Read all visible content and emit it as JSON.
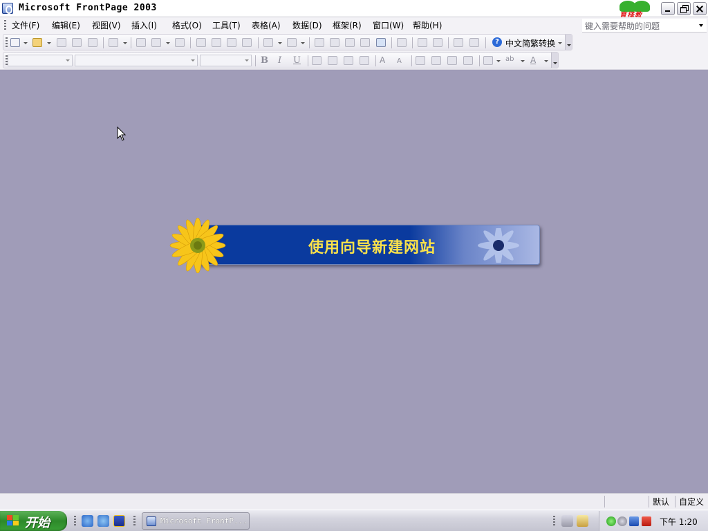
{
  "window": {
    "title": "Microsoft FrontPage 2003"
  },
  "logo": {
    "text": "育择教"
  },
  "menu": {
    "items": [
      {
        "label": "文件(F)"
      },
      {
        "label": "编辑(E)"
      },
      {
        "label": "视图(V)"
      },
      {
        "label": "插入(I)"
      },
      {
        "label": "格式(O)"
      },
      {
        "label": "工具(T)"
      },
      {
        "label": "表格(A)"
      },
      {
        "label": "数据(D)"
      },
      {
        "label": "框架(R)"
      },
      {
        "label": "窗口(W)"
      },
      {
        "label": "帮助(H)"
      }
    ]
  },
  "help_search": {
    "placeholder": "键入需要帮助的问题"
  },
  "toolbar": {
    "chinese_convert_label": "中文简繁转换",
    "help_glyph": "?"
  },
  "format_toolbar": {
    "bold": "B",
    "italic": "I",
    "underline": "U",
    "grow_font": "A",
    "shrink_font": "A",
    "font_color": "A",
    "spelling": "ab"
  },
  "banner": {
    "label": "使用向导新建网站"
  },
  "statusbar": {
    "mode": "默认",
    "custom": "自定义"
  },
  "taskbar": {
    "start_label": "开始",
    "task_button_label": "Microsoft FrontP...",
    "clock": "下午 1:20"
  },
  "colors": {
    "workspace": "#a09cb8",
    "banner_blue": "#0a3a9e",
    "banner_text": "#fbe24a",
    "start_green": "#2d8a2a"
  }
}
